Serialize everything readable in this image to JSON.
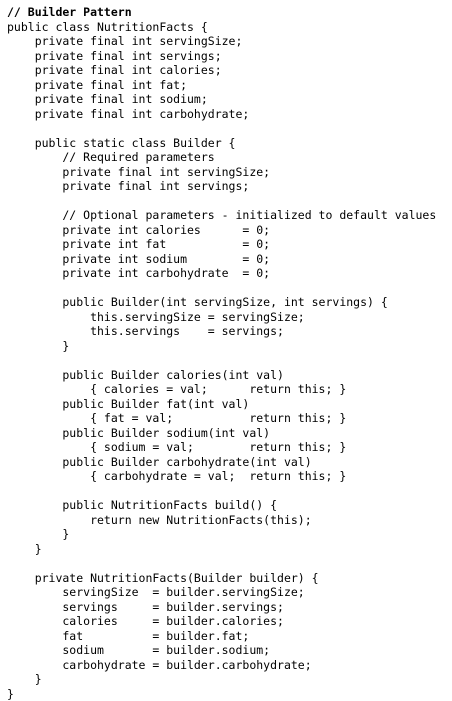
{
  "code": {
    "lines": [
      "// Builder Pattern",
      "public class NutritionFacts {",
      "    private final int servingSize;",
      "    private final int servings;",
      "    private final int calories;",
      "    private final int fat;",
      "    private final int sodium;",
      "    private final int carbohydrate;",
      "",
      "    public static class Builder {",
      "        // Required parameters",
      "        private final int servingSize;",
      "        private final int servings;",
      "",
      "        // Optional parameters - initialized to default values",
      "        private int calories      = 0;",
      "        private int fat           = 0;",
      "        private int sodium        = 0;",
      "        private int carbohydrate  = 0;",
      "",
      "        public Builder(int servingSize, int servings) {",
      "            this.servingSize = servingSize;",
      "            this.servings    = servings;",
      "        }",
      "",
      "        public Builder calories(int val)",
      "            { calories = val;      return this; }",
      "        public Builder fat(int val)",
      "            { fat = val;           return this; }",
      "        public Builder sodium(int val)",
      "            { sodium = val;        return this; }",
      "        public Builder carbohydrate(int val)",
      "            { carbohydrate = val;  return this; }",
      "",
      "        public NutritionFacts build() {",
      "            return new NutritionFacts(this);",
      "        }",
      "    }",
      "",
      "    private NutritionFacts(Builder builder) {",
      "        servingSize  = builder.servingSize;",
      "        servings     = builder.servings;",
      "        calories     = builder.calories;",
      "        fat          = builder.fat;",
      "        sodium       = builder.sodium;",
      "        carbohydrate = builder.carbohydrate;",
      "    }",
      "}"
    ]
  }
}
